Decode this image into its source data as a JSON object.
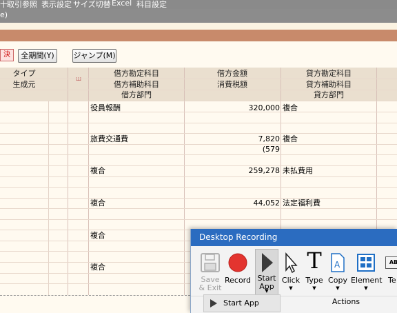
{
  "menu": {
    "items": [
      "取引参照",
      "表示設定",
      "サイズ切替",
      "Excel",
      "科目設定"
    ],
    "prefix_glyph": "十"
  },
  "titlebar": {
    "text": "e)"
  },
  "toolbar": {
    "kessan_label": "決",
    "all_period_label": "全期間(Y)",
    "jump_label": "ジャンプ(M)"
  },
  "table": {
    "headers_row1": {
      "type": "タイプ",
      "debit_account": "借方勘定科目",
      "debit_amount": "借方金額",
      "credit_account": "貸方勘定科目"
    },
    "headers_row2": {
      "origin": "生成元",
      "debit_sub": "借方補助科目",
      "tax": "消費税額",
      "credit_sub": "貸方補助科目"
    },
    "headers_row3": {
      "debit_dept": "借方部門",
      "credit_dept": "貸方部門"
    },
    "marker_col_glyph": "ш",
    "rows": [
      {
        "debit_account": "役員報酬",
        "amount": "320,000",
        "credit_account": "複合",
        "tax": ""
      },
      {
        "debit_account": "旅費交通費",
        "amount": "7,820",
        "credit_account": "複合",
        "tax": "(579"
      },
      {
        "debit_account": "複合",
        "amount": "259,278",
        "credit_account": "未払費用",
        "tax": ""
      },
      {
        "debit_account": "複合",
        "amount": "44,052",
        "credit_account": "法定福利費",
        "tax": ""
      },
      {
        "debit_account": "複合",
        "amount": "",
        "credit_account": "",
        "tax": ""
      },
      {
        "debit_account": "複合",
        "amount": "",
        "credit_account": "",
        "tax": ""
      }
    ]
  },
  "recorder": {
    "title": "Desktop Recording",
    "buttons": {
      "save_exit": "Save\n& Exit",
      "record": "Record",
      "start_app": "Start\nApp",
      "click": "Click",
      "type": "Type",
      "copy": "Copy",
      "element": "Element",
      "more": "Te"
    },
    "group_label": "Actions",
    "dropdown_item": "Start App",
    "colors": {
      "title_bg": "#2b6cc0",
      "record_red": "#e3342f",
      "element_blue": "#1f6fc5"
    }
  }
}
